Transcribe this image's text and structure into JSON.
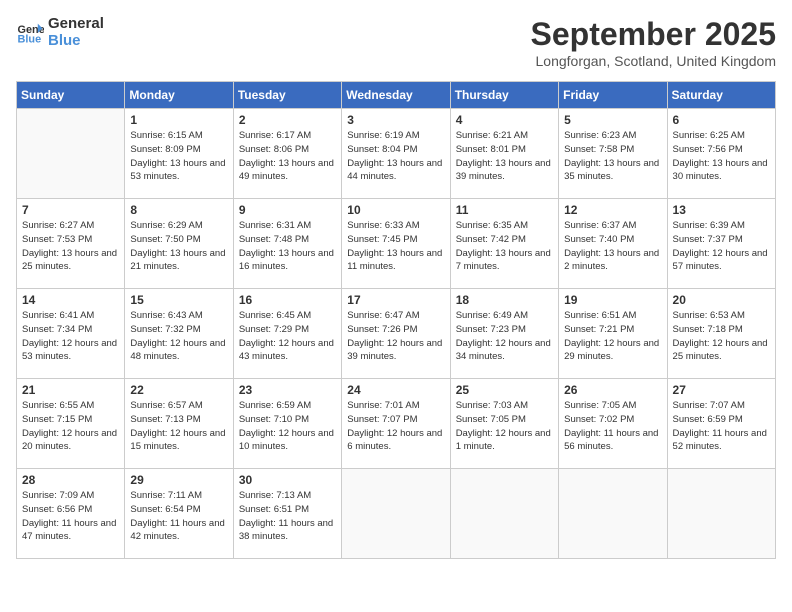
{
  "header": {
    "logo_line1": "General",
    "logo_line2": "Blue",
    "month_title": "September 2025",
    "location": "Longforgan, Scotland, United Kingdom"
  },
  "days_of_week": [
    "Sunday",
    "Monday",
    "Tuesday",
    "Wednesday",
    "Thursday",
    "Friday",
    "Saturday"
  ],
  "weeks": [
    [
      {
        "num": "",
        "sunrise": "",
        "sunset": "",
        "daylight": ""
      },
      {
        "num": "1",
        "sunrise": "Sunrise: 6:15 AM",
        "sunset": "Sunset: 8:09 PM",
        "daylight": "Daylight: 13 hours and 53 minutes."
      },
      {
        "num": "2",
        "sunrise": "Sunrise: 6:17 AM",
        "sunset": "Sunset: 8:06 PM",
        "daylight": "Daylight: 13 hours and 49 minutes."
      },
      {
        "num": "3",
        "sunrise": "Sunrise: 6:19 AM",
        "sunset": "Sunset: 8:04 PM",
        "daylight": "Daylight: 13 hours and 44 minutes."
      },
      {
        "num": "4",
        "sunrise": "Sunrise: 6:21 AM",
        "sunset": "Sunset: 8:01 PM",
        "daylight": "Daylight: 13 hours and 39 minutes."
      },
      {
        "num": "5",
        "sunrise": "Sunrise: 6:23 AM",
        "sunset": "Sunset: 7:58 PM",
        "daylight": "Daylight: 13 hours and 35 minutes."
      },
      {
        "num": "6",
        "sunrise": "Sunrise: 6:25 AM",
        "sunset": "Sunset: 7:56 PM",
        "daylight": "Daylight: 13 hours and 30 minutes."
      }
    ],
    [
      {
        "num": "7",
        "sunrise": "Sunrise: 6:27 AM",
        "sunset": "Sunset: 7:53 PM",
        "daylight": "Daylight: 13 hours and 25 minutes."
      },
      {
        "num": "8",
        "sunrise": "Sunrise: 6:29 AM",
        "sunset": "Sunset: 7:50 PM",
        "daylight": "Daylight: 13 hours and 21 minutes."
      },
      {
        "num": "9",
        "sunrise": "Sunrise: 6:31 AM",
        "sunset": "Sunset: 7:48 PM",
        "daylight": "Daylight: 13 hours and 16 minutes."
      },
      {
        "num": "10",
        "sunrise": "Sunrise: 6:33 AM",
        "sunset": "Sunset: 7:45 PM",
        "daylight": "Daylight: 13 hours and 11 minutes."
      },
      {
        "num": "11",
        "sunrise": "Sunrise: 6:35 AM",
        "sunset": "Sunset: 7:42 PM",
        "daylight": "Daylight: 13 hours and 7 minutes."
      },
      {
        "num": "12",
        "sunrise": "Sunrise: 6:37 AM",
        "sunset": "Sunset: 7:40 PM",
        "daylight": "Daylight: 13 hours and 2 minutes."
      },
      {
        "num": "13",
        "sunrise": "Sunrise: 6:39 AM",
        "sunset": "Sunset: 7:37 PM",
        "daylight": "Daylight: 12 hours and 57 minutes."
      }
    ],
    [
      {
        "num": "14",
        "sunrise": "Sunrise: 6:41 AM",
        "sunset": "Sunset: 7:34 PM",
        "daylight": "Daylight: 12 hours and 53 minutes."
      },
      {
        "num": "15",
        "sunrise": "Sunrise: 6:43 AM",
        "sunset": "Sunset: 7:32 PM",
        "daylight": "Daylight: 12 hours and 48 minutes."
      },
      {
        "num": "16",
        "sunrise": "Sunrise: 6:45 AM",
        "sunset": "Sunset: 7:29 PM",
        "daylight": "Daylight: 12 hours and 43 minutes."
      },
      {
        "num": "17",
        "sunrise": "Sunrise: 6:47 AM",
        "sunset": "Sunset: 7:26 PM",
        "daylight": "Daylight: 12 hours and 39 minutes."
      },
      {
        "num": "18",
        "sunrise": "Sunrise: 6:49 AM",
        "sunset": "Sunset: 7:23 PM",
        "daylight": "Daylight: 12 hours and 34 minutes."
      },
      {
        "num": "19",
        "sunrise": "Sunrise: 6:51 AM",
        "sunset": "Sunset: 7:21 PM",
        "daylight": "Daylight: 12 hours and 29 minutes."
      },
      {
        "num": "20",
        "sunrise": "Sunrise: 6:53 AM",
        "sunset": "Sunset: 7:18 PM",
        "daylight": "Daylight: 12 hours and 25 minutes."
      }
    ],
    [
      {
        "num": "21",
        "sunrise": "Sunrise: 6:55 AM",
        "sunset": "Sunset: 7:15 PM",
        "daylight": "Daylight: 12 hours and 20 minutes."
      },
      {
        "num": "22",
        "sunrise": "Sunrise: 6:57 AM",
        "sunset": "Sunset: 7:13 PM",
        "daylight": "Daylight: 12 hours and 15 minutes."
      },
      {
        "num": "23",
        "sunrise": "Sunrise: 6:59 AM",
        "sunset": "Sunset: 7:10 PM",
        "daylight": "Daylight: 12 hours and 10 minutes."
      },
      {
        "num": "24",
        "sunrise": "Sunrise: 7:01 AM",
        "sunset": "Sunset: 7:07 PM",
        "daylight": "Daylight: 12 hours and 6 minutes."
      },
      {
        "num": "25",
        "sunrise": "Sunrise: 7:03 AM",
        "sunset": "Sunset: 7:05 PM",
        "daylight": "Daylight: 12 hours and 1 minute."
      },
      {
        "num": "26",
        "sunrise": "Sunrise: 7:05 AM",
        "sunset": "Sunset: 7:02 PM",
        "daylight": "Daylight: 11 hours and 56 minutes."
      },
      {
        "num": "27",
        "sunrise": "Sunrise: 7:07 AM",
        "sunset": "Sunset: 6:59 PM",
        "daylight": "Daylight: 11 hours and 52 minutes."
      }
    ],
    [
      {
        "num": "28",
        "sunrise": "Sunrise: 7:09 AM",
        "sunset": "Sunset: 6:56 PM",
        "daylight": "Daylight: 11 hours and 47 minutes."
      },
      {
        "num": "29",
        "sunrise": "Sunrise: 7:11 AM",
        "sunset": "Sunset: 6:54 PM",
        "daylight": "Daylight: 11 hours and 42 minutes."
      },
      {
        "num": "30",
        "sunrise": "Sunrise: 7:13 AM",
        "sunset": "Sunset: 6:51 PM",
        "daylight": "Daylight: 11 hours and 38 minutes."
      },
      {
        "num": "",
        "sunrise": "",
        "sunset": "",
        "daylight": ""
      },
      {
        "num": "",
        "sunrise": "",
        "sunset": "",
        "daylight": ""
      },
      {
        "num": "",
        "sunrise": "",
        "sunset": "",
        "daylight": ""
      },
      {
        "num": "",
        "sunrise": "",
        "sunset": "",
        "daylight": ""
      }
    ]
  ]
}
